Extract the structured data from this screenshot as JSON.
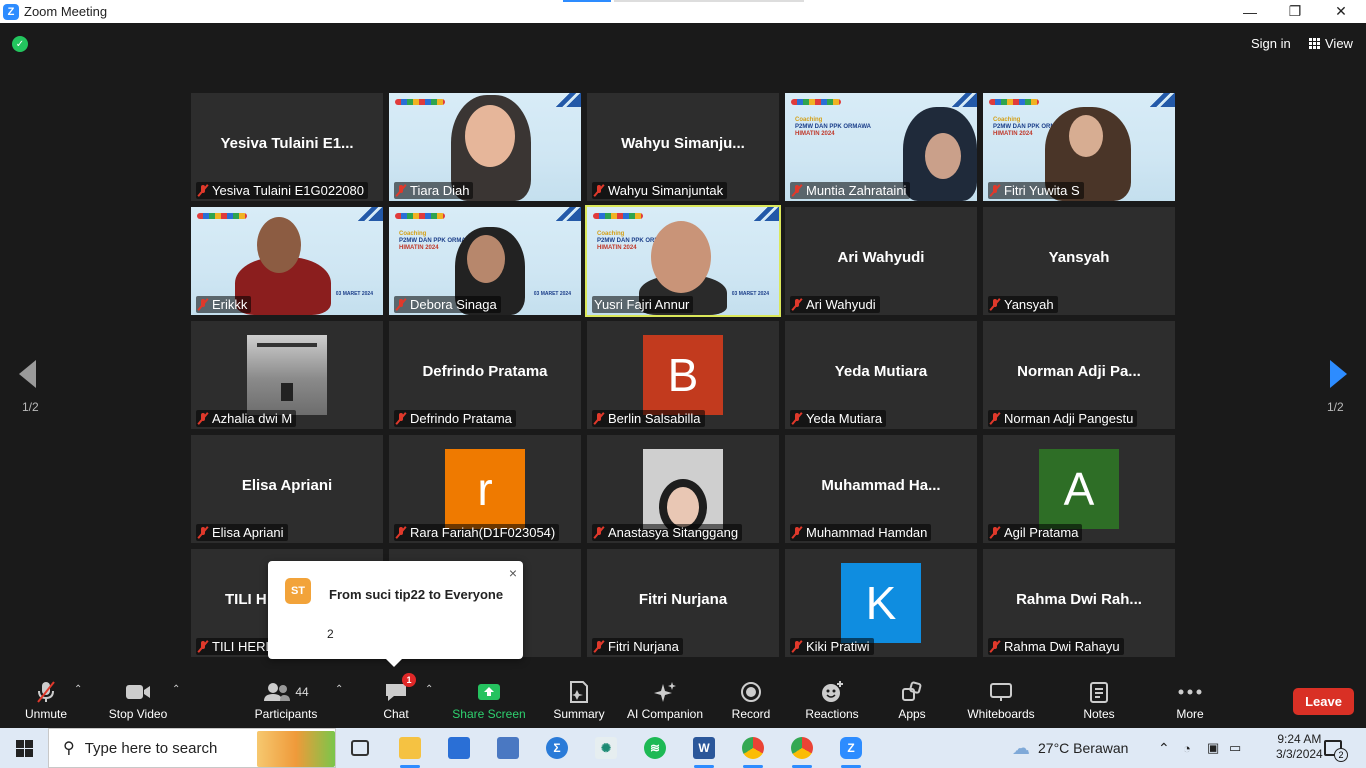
{
  "window": {
    "title": "Zoom Meeting"
  },
  "header": {
    "sign_in": "Sign in",
    "view": "View"
  },
  "pagination": {
    "left": "1/2",
    "right": "1/2"
  },
  "tiles": [
    {
      "big": "Yesiva Tulaini E1...",
      "name": "Yesiva Tulaini E1G022080"
    },
    {
      "big": "",
      "name": "Tiara Diah"
    },
    {
      "big": "Wahyu Simanju...",
      "name": "Wahyu Simanjuntak"
    },
    {
      "big": "",
      "name": "Muntia Zahrataini"
    },
    {
      "big": "",
      "name": "Fitri Yuwita S"
    },
    {
      "big": "",
      "name": "Erikkk"
    },
    {
      "big": "",
      "name": "Debora Sinaga"
    },
    {
      "big": "",
      "name": "Yusri Fajri Annur"
    },
    {
      "big": "Ari Wahyudi",
      "name": "Ari Wahyudi"
    },
    {
      "big": "Yansyah",
      "name": "Yansyah"
    },
    {
      "big": "",
      "name": "Azhalia dwi M"
    },
    {
      "big": "Defrindo Pratama",
      "name": "Defrindo Pratama"
    },
    {
      "big": "B",
      "name": "Berlin Salsabilla"
    },
    {
      "big": "Yeda Mutiara",
      "name": "Yeda Mutiara"
    },
    {
      "big": "Norman Adji Pa...",
      "name": "Norman Adji Pangestu"
    },
    {
      "big": "Elisa Apriani",
      "name": "Elisa Apriani"
    },
    {
      "big": "r",
      "name": "Rara Fariah(D1F023054)"
    },
    {
      "big": "",
      "name": "Anastasya Sitanggang"
    },
    {
      "big": "Muhammad Ha...",
      "name": "Muhammad Hamdan"
    },
    {
      "big": "A",
      "name": "Agil Pratama"
    },
    {
      "big": "TILI H",
      "name": "TILI HERLI"
    },
    {
      "big": "",
      "name": ""
    },
    {
      "big": "Fitri Nurjana",
      "name": "Fitri Nurjana"
    },
    {
      "big": "K",
      "name": "Kiki Pratiwi"
    },
    {
      "big": "Rahma Dwi Rah...",
      "name": "Rahma Dwi Rahayu"
    }
  ],
  "banner": {
    "l1": "Coaching",
    "l2": "P2MW DAN PPK ORMAWA",
    "l3": "HIMATIN 2024",
    "date": "03 MARET 2024"
  },
  "colors": {
    "active_speaker": "#dbe85a",
    "b": "#c23a1e",
    "r": "#ef7a00",
    "a": "#2e6e26",
    "k": "#0f8de0",
    "leave": "#d93025"
  },
  "chat_toast": {
    "avatar": "ST",
    "title": "From suci tip22 to Everyone",
    "message": "2",
    "close": "×"
  },
  "toolbar": {
    "unmute": "Unmute",
    "stop_video": "Stop Video",
    "participants": "Participants",
    "participants_count": "44",
    "chat": "Chat",
    "chat_badge": "1",
    "share_screen": "Share Screen",
    "summary": "Summary",
    "ai_companion": "AI Companion",
    "record": "Record",
    "reactions": "Reactions",
    "apps": "Apps",
    "whiteboards": "Whiteboards",
    "notes": "Notes",
    "more": "More",
    "leave": "Leave"
  },
  "taskbar": {
    "search_placeholder": "Type here to search",
    "weather": "27°C  Berawan",
    "time": "9:24 AM",
    "date": "3/3/2024",
    "notifications": "2"
  }
}
